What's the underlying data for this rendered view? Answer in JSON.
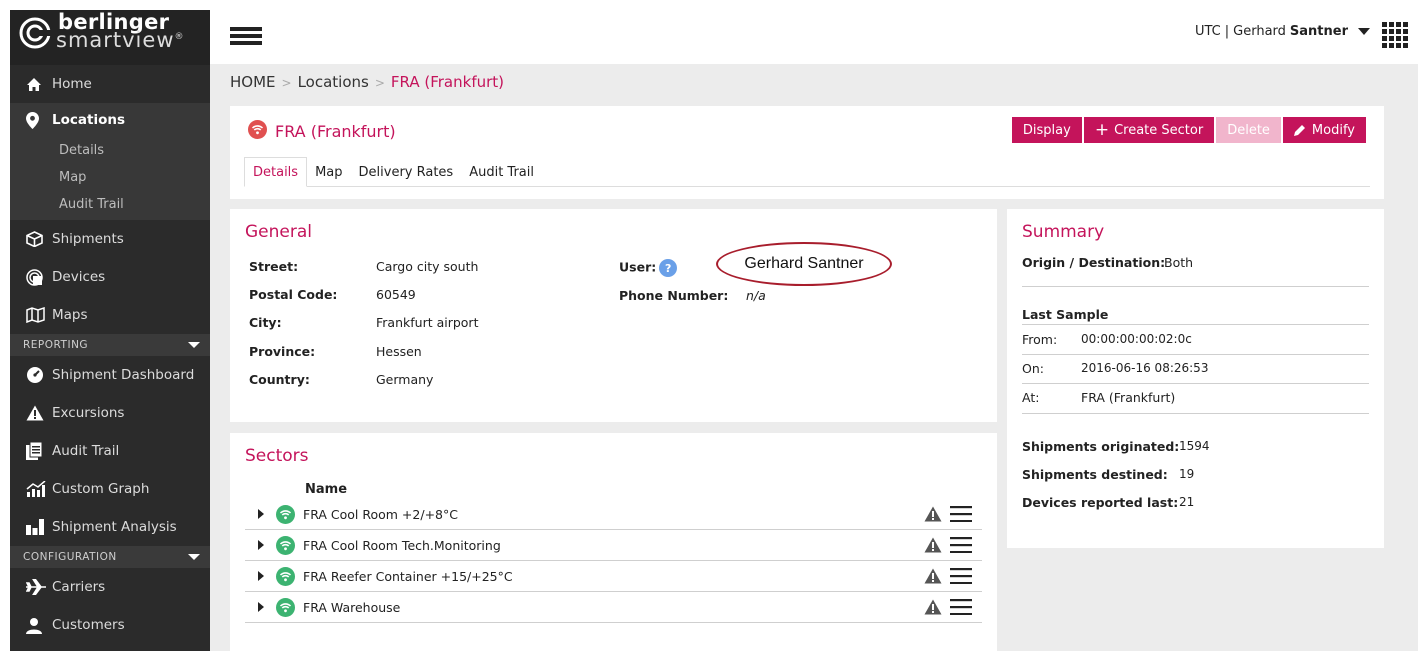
{
  "app": {
    "logo_line1": "berlinger",
    "logo_line2": "smartview"
  },
  "topbar": {
    "timezone": "UTC",
    "user_first": "Gerhard",
    "user_last": "Santner"
  },
  "sidebar": {
    "items": [
      {
        "label": "Home",
        "icon": "home-icon"
      },
      {
        "label": "Locations",
        "icon": "map-pin-icon",
        "active": true,
        "sub": [
          "Details",
          "Map",
          "Audit Trail"
        ]
      },
      {
        "label": "Shipments",
        "icon": "box-icon"
      },
      {
        "label": "Devices",
        "icon": "device-icon"
      },
      {
        "label": "Maps",
        "icon": "map-icon"
      }
    ],
    "reporting_label": "REPORTING",
    "reporting": [
      {
        "label": "Shipment Dashboard",
        "icon": "dashboard-icon"
      },
      {
        "label": "Excursions",
        "icon": "warning-icon"
      },
      {
        "label": "Audit Trail",
        "icon": "document-icon"
      },
      {
        "label": "Custom Graph",
        "icon": "graph-icon"
      },
      {
        "label": "Shipment Analysis",
        "icon": "analysis-icon"
      }
    ],
    "configuration_label": "CONFIGURATION",
    "configuration": [
      {
        "label": "Carriers",
        "icon": "plane-icon"
      },
      {
        "label": "Customers",
        "icon": "user-icon"
      }
    ]
  },
  "breadcrumb": {
    "home": "HOME",
    "locations": "Locations",
    "current": "FRA (Frankfurt)"
  },
  "location": {
    "title": "FRA (Frankfurt)"
  },
  "actions": {
    "display": "Display",
    "create_sector": "Create Sector",
    "delete": "Delete",
    "modify": "Modify"
  },
  "tabs": [
    "Details",
    "Map",
    "Delivery Rates",
    "Audit Trail"
  ],
  "general": {
    "title": "General",
    "street_label": "Street:",
    "street": "Cargo city south",
    "postal_label": "Postal Code:",
    "postal": "60549",
    "city_label": "City:",
    "city": "Frankfurt airport",
    "province_label": "Province:",
    "province": "Hessen",
    "country_label": "Country:",
    "country": "Germany",
    "user_label": "User:",
    "user_help": "?",
    "phone_label": "Phone Number:",
    "phone": "n/a",
    "annotation": "Gerhard Santner"
  },
  "sectors": {
    "title": "Sectors",
    "name_header": "Name",
    "rows": [
      "FRA Cool Room +2/+8°C",
      "FRA Cool Room Tech.Monitoring",
      "FRA Reefer Container +15/+25°C",
      "FRA Warehouse"
    ]
  },
  "summary": {
    "title": "Summary",
    "od_label": "Origin / Destination:",
    "od_value": "Both",
    "last_sample": "Last Sample",
    "from_label": "From:",
    "from_value": "00:00:00:00:02:0c",
    "on_label": "On:",
    "on_value": "2016-06-16 08:26:53",
    "at_label": "At:",
    "at_value": "FRA (Frankfurt)",
    "orig_label": "Shipments originated:",
    "orig_value": "1594",
    "dest_label": "Shipments destined:",
    "dest_value": "19",
    "dev_label": "Devices reported last:",
    "dev_value": "21"
  },
  "colors": {
    "accent": "#c4145b",
    "sidebar": "#2b2b2b",
    "ok": "#3cb371",
    "alert": "#e05050"
  }
}
